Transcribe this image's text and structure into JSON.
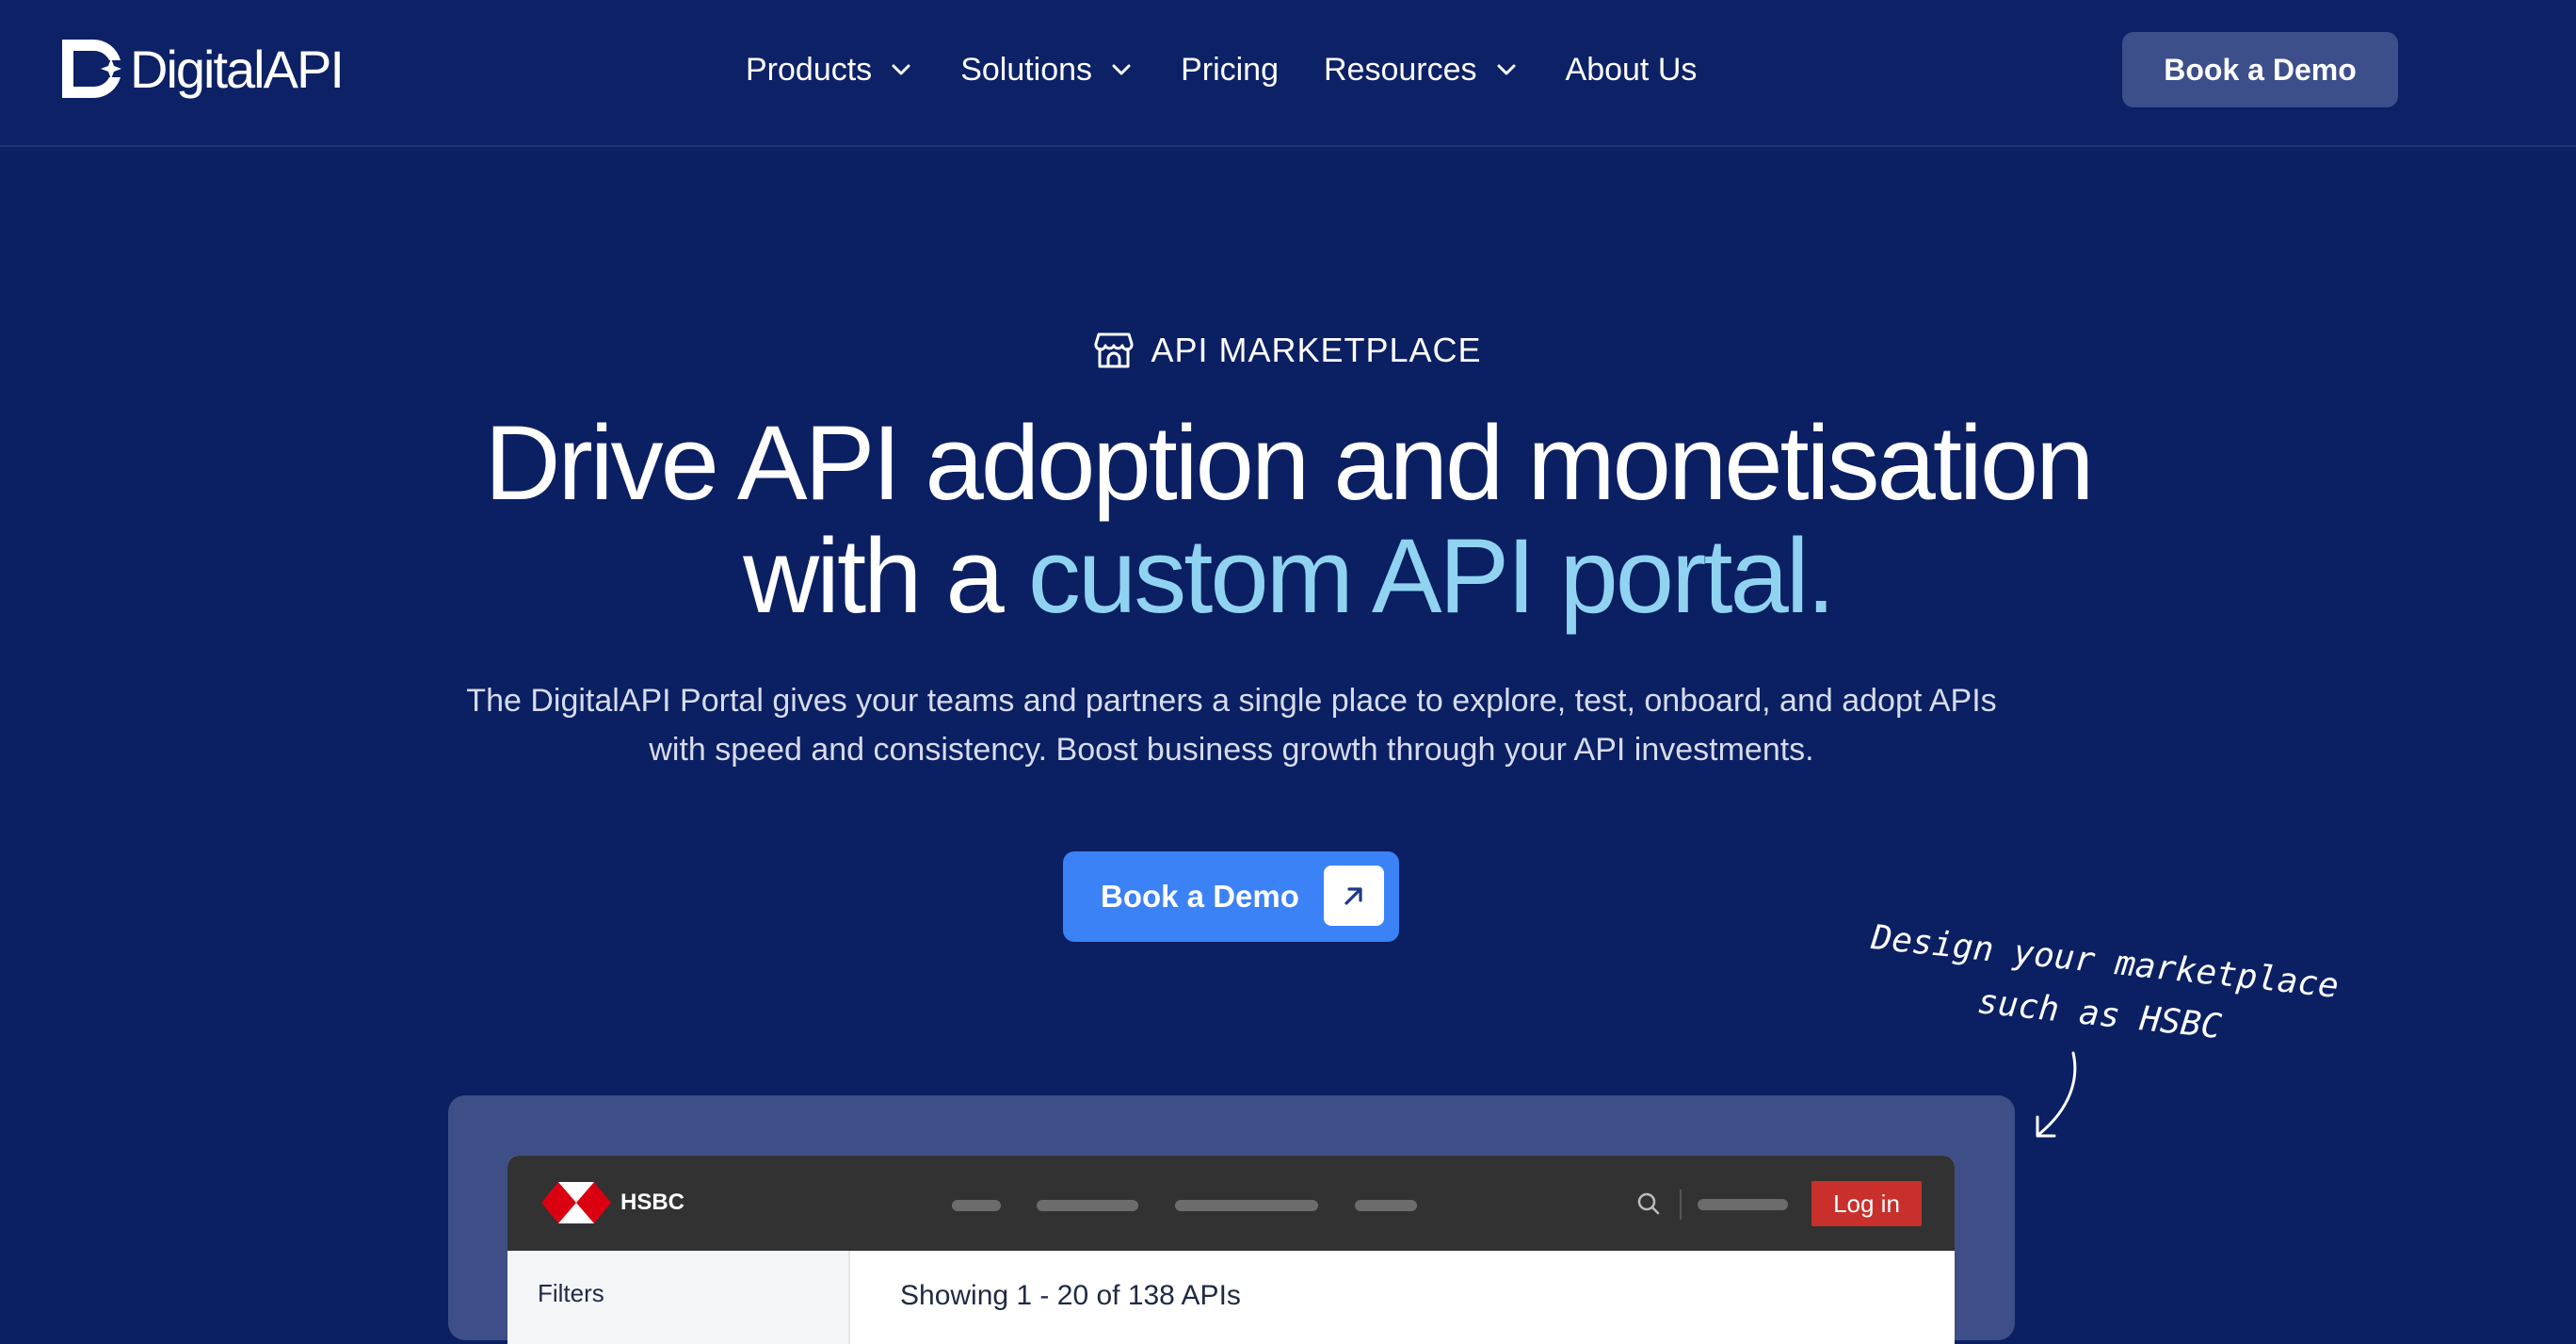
{
  "brand": {
    "name": "DigitalAPI"
  },
  "nav": {
    "items": [
      {
        "label": "Products",
        "has_dropdown": true
      },
      {
        "label": "Solutions",
        "has_dropdown": true
      },
      {
        "label": "Pricing",
        "has_dropdown": false
      },
      {
        "label": "Resources",
        "has_dropdown": true
      },
      {
        "label": "About Us",
        "has_dropdown": false
      }
    ],
    "cta_label": "Book a Demo"
  },
  "hero": {
    "eyebrow": "API MARKETPLACE",
    "eyebrow_icon": "storefront-icon",
    "headline_line1": "Drive API adoption and monetisation",
    "headline_line2_prefix": "with a ",
    "headline_line2_accent": "custom API portal.",
    "subtext": "The DigitalAPI Portal gives your teams and partners a single place to explore, test, onboard, and adopt APIs with speed and consistency. Boost business growth through your API investments.",
    "cta_label": "Book a Demo",
    "cta_icon": "arrow-up-right-icon",
    "annotation_line1": "Design your marketplace",
    "annotation_line2": "such as HSBC"
  },
  "preview": {
    "brand": "HSBC",
    "login_label": "Log in",
    "filters_label": "Filters",
    "results_text": "Showing 1 - 20 of 138 APIs"
  },
  "colors": {
    "background": "#0b1f63",
    "accent_text": "#8fd3f0",
    "primary_button": "#3b82f6",
    "header_button": "#3c4f8a",
    "hsbc_red": "#c9302c"
  }
}
